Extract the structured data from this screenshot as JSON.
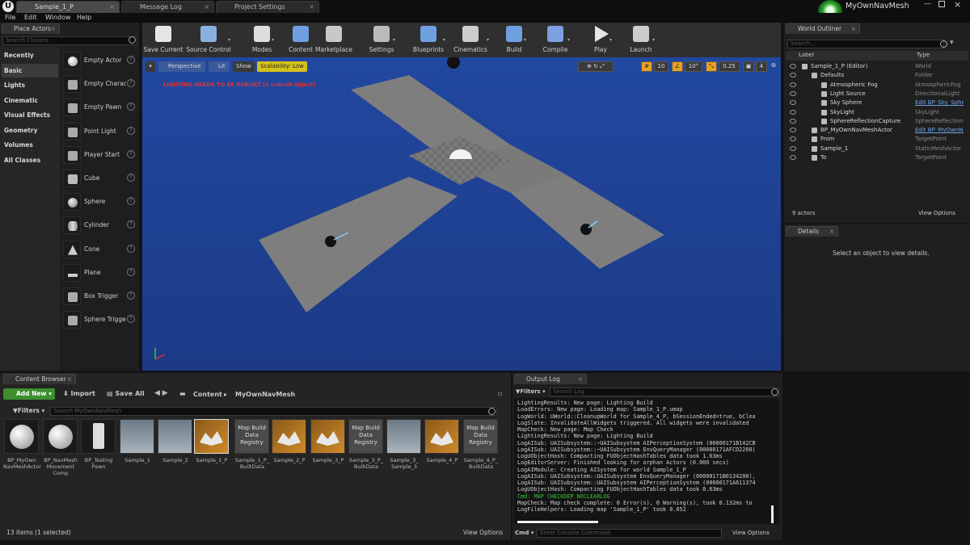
{
  "tabs": [
    {
      "label": "Sample_1_P",
      "active": true
    },
    {
      "label": "Message Log",
      "active": false
    },
    {
      "label": "Project Settings",
      "active": false
    }
  ],
  "project_name": "MyOwnNavMesh",
  "menu": [
    "File",
    "Edit",
    "Window",
    "Help"
  ],
  "place_actors": {
    "tab": "Place Actors",
    "search_placeholder": "Search Classes",
    "categories": [
      "Recently Placed",
      "Basic",
      "Lights",
      "Cinematic",
      "Visual Effects",
      "Geometry",
      "Volumes",
      "All Classes"
    ],
    "selected_category": "Basic",
    "actors": [
      "Empty Actor",
      "Empty Character",
      "Empty Pawn",
      "Point Light",
      "Player Start",
      "Cube",
      "Sphere",
      "Cylinder",
      "Cone",
      "Plane",
      "Box Trigger",
      "Sphere Trigger"
    ]
  },
  "toolbar": [
    {
      "label": "Save Current",
      "icon": "save-icon"
    },
    {
      "label": "Source Control",
      "icon": "source-control-icon"
    },
    {
      "label": "Modes",
      "icon": "modes-icon"
    },
    {
      "label": "Content",
      "icon": "content-icon"
    },
    {
      "label": "Marketplace",
      "icon": "marketplace-icon"
    },
    {
      "label": "Settings",
      "icon": "settings-icon"
    },
    {
      "label": "Blueprints",
      "icon": "blueprints-icon"
    },
    {
      "label": "Cinematics",
      "icon": "cinematics-icon"
    },
    {
      "label": "Build",
      "icon": "build-icon"
    },
    {
      "label": "Compile",
      "icon": "compile-icon"
    },
    {
      "label": "Play",
      "icon": "play-icon"
    },
    {
      "label": "Launch",
      "icon": "launch-icon"
    }
  ],
  "viewport": {
    "perspective": "Perspective",
    "lit": "Lit",
    "show": "Show",
    "scalability": "Scalability: Low",
    "warning": "LIGHTING NEEDS TO BE REBUILT (1 unbuilt object)",
    "grid_snap": "10",
    "rot_snap": "10°",
    "scale_snap": "0.25",
    "camera_speed": "4",
    "colors": {
      "sky_top": "#2148a0",
      "floor": "#7e7e7e",
      "warning": "#e03030",
      "scalability": "#d4c21a"
    }
  },
  "world_outliner": {
    "tab": "World Outliner",
    "search_placeholder": "Search...",
    "col_label": "Label",
    "col_type": "Type",
    "rows": [
      {
        "label": "Sample_1_P (Editor)",
        "type": "World",
        "indent": 0,
        "link": false
      },
      {
        "label": "Defaults",
        "type": "Folder",
        "indent": 1,
        "link": false
      },
      {
        "label": "Atmospheric Fog",
        "type": "AtmosphericFog",
        "indent": 2,
        "link": false
      },
      {
        "label": "Light Source",
        "type": "DirectionalLight",
        "indent": 2,
        "link": false
      },
      {
        "label": "Sky Sphere",
        "type": "Edit BP_Sky_Sphere",
        "indent": 2,
        "link": true
      },
      {
        "label": "SkyLight",
        "type": "SkyLight",
        "indent": 2,
        "link": false
      },
      {
        "label": "SphereReflectionCapture",
        "type": "SphereReflectionCapture",
        "indent": 2,
        "link": false
      },
      {
        "label": "BP_MyOwnNavMeshActor",
        "type": "Edit BP_MyOwnNavMeshActor",
        "indent": 1,
        "link": true
      },
      {
        "label": "From",
        "type": "TargetPoint",
        "indent": 1,
        "link": false
      },
      {
        "label": "Sample_1",
        "type": "StaticMeshActor",
        "indent": 1,
        "link": false
      },
      {
        "label": "To",
        "type": "TargetPoint",
        "indent": 1,
        "link": false
      }
    ],
    "count": "9 actors",
    "view_options": "View Options"
  },
  "details": {
    "tab": "Details",
    "empty": "Select an object to view details."
  },
  "content_browser": {
    "tab": "Content Browser",
    "add_new": "Add New",
    "import": "Import",
    "save_all": "Save All",
    "breadcrumb_root": "Content",
    "breadcrumb_folder": "MyOwnNavMesh",
    "filters": "Filters",
    "search_placeholder": "Search MyOwnNavMesh",
    "assets": [
      {
        "label": "BP_MyOwn NavMeshActor",
        "kind": "bp"
      },
      {
        "label": "BP_NavMesh Movement Comp",
        "kind": "bpcomp"
      },
      {
        "label": "BP_Testing Pawn",
        "kind": "pawn"
      },
      {
        "label": "Sample_1",
        "kind": "mesh"
      },
      {
        "label": "Sample_2",
        "kind": "mesh2"
      },
      {
        "label": "Sample_1_P",
        "kind": "map",
        "selected": true
      },
      {
        "label": "Sample_1_P_ BuiltData",
        "kind": "data",
        "text": "Map Build Data Registry"
      },
      {
        "label": "Sample_2_P",
        "kind": "map"
      },
      {
        "label": "Sample_3_P",
        "kind": "map"
      },
      {
        "label": "Sample_3_P_ BuiltData",
        "kind": "data",
        "text": "Map Build Data Registry"
      },
      {
        "label": "Sample_3_ Sample_3",
        "kind": "mesh3"
      },
      {
        "label": "Sample_4_P",
        "kind": "map"
      },
      {
        "label": "Sample_4_P_ BuiltData",
        "kind": "data",
        "text": "Map Build Data Registry"
      }
    ],
    "status": "13 items (1 selected)",
    "view_options": "View Options"
  },
  "output_log": {
    "tab": "Output Log",
    "filters": "Filters",
    "search_placeholder": "Search Log",
    "lines": [
      {
        "text": "LightingResults: New page: Lighting Build",
        "cmd": false
      },
      {
        "text": "LoadErrors: New page: Loading map: Sample_1_P.umap",
        "cmd": false
      },
      {
        "text": "LogWorld: UWorld::CleanupWorld for Sample_4_P, bSessionEnded=true, bClea",
        "cmd": false
      },
      {
        "text": "LogSlate: InvalidateAllWidgets triggered.  All widgets were invalidated",
        "cmd": false
      },
      {
        "text": "MapCheck: New page: Map Check",
        "cmd": false
      },
      {
        "text": "LightingResults: New page: Lighting Build",
        "cmd": false
      },
      {
        "text": "LogAISub: UAISubsystem::~UAISubsystem AIPerceptionSystem (00000171B142CB",
        "cmd": false
      },
      {
        "text": "LogAISub: UAISubsystem::~UAISubsystem EnvQueryManager (00000171AFCD2200)",
        "cmd": false
      },
      {
        "text": "LogUObjectHash: Compacting FUObjectHashTables data took   1.63ms",
        "cmd": false
      },
      {
        "text": "LogEditorServer: Finished looking for orphan Actors (0.000 secs)",
        "cmd": false
      },
      {
        "text": "LogAIModule: Creating AISystem for world Sample_1_P",
        "cmd": false
      },
      {
        "text": "LogAISub: UAISubsystem::UAISubsystem EnvQueryManager (00000171B0134200),",
        "cmd": false
      },
      {
        "text": "LogAISub: UAISubsystem::UAISubsystem AIPerceptionSystem (00000171A611374",
        "cmd": false
      },
      {
        "text": "LogUObjectHash: Compacting FUObjectHashTables data took   0.63ms",
        "cmd": false
      },
      {
        "text": "Cmd: MAP CHECKDEP NOCLEARLOG",
        "cmd": true
      },
      {
        "text": "MapCheck: Map check complete: 0 Error(s), 0 Warning(s), took 0.132ms to",
        "cmd": false
      },
      {
        "text": "LogFileHelpers: Loading map 'Sample_1_P' took 0.052",
        "cmd": false
      }
    ],
    "cmd_label": "Cmd",
    "cmd_placeholder": "Enter Console Command",
    "view_options": "View Options"
  }
}
